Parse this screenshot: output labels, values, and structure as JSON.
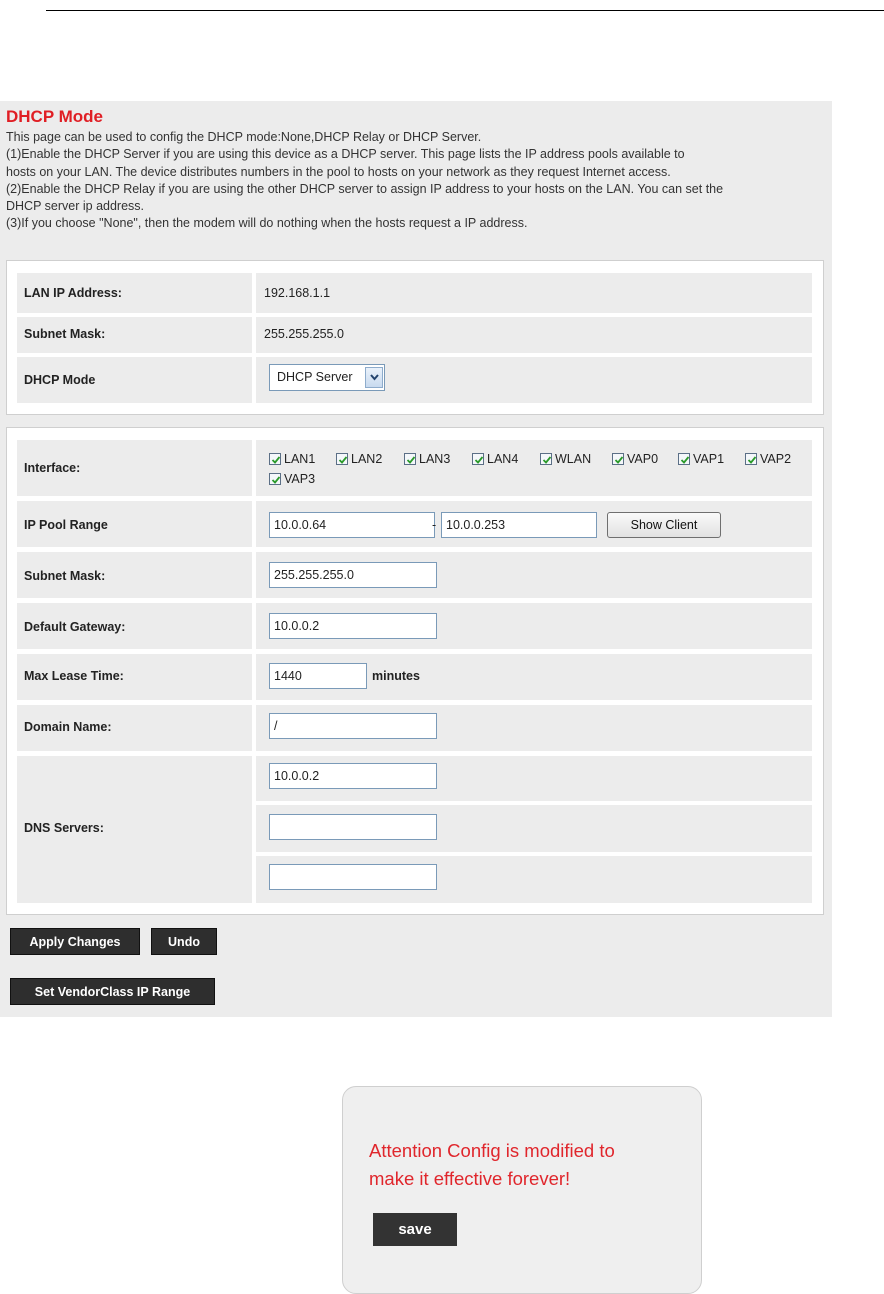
{
  "title": "DHCP Mode",
  "description": [
    "This page can be used to config the DHCP mode:None,DHCP Relay or DHCP Server.",
    "(1)Enable the DHCP Server if you are using this device as a DHCP server. This page lists the IP address pools available to",
    "hosts on your LAN. The device distributes numbers in the pool to hosts on your network as they request Internet access.",
    "(2)Enable the DHCP Relay if you are using the other DHCP server to assign IP address to your hosts on the LAN. You can set the",
    "DHCP server ip address.",
    "(3)If you choose \"None\", then the modem will do nothing when the hosts request a IP address."
  ],
  "lan": {
    "ip_label": "LAN IP Address:",
    "ip_value": "192.168.1.1",
    "mask_label": "Subnet Mask:",
    "mask_value": "255.255.255.0",
    "mode_label": "DHCP Mode",
    "mode_value": "DHCP Server"
  },
  "server": {
    "interface_label": "Interface:",
    "interfaces": [
      {
        "name": "LAN1",
        "checked": true
      },
      {
        "name": "LAN2",
        "checked": true
      },
      {
        "name": "LAN3",
        "checked": true
      },
      {
        "name": "LAN4",
        "checked": true
      },
      {
        "name": "WLAN",
        "checked": true
      },
      {
        "name": "VAP0",
        "checked": true
      },
      {
        "name": "VAP1",
        "checked": true
      },
      {
        "name": "VAP2",
        "checked": true
      },
      {
        "name": "VAP3",
        "checked": true
      }
    ],
    "pool_label": "IP Pool Range",
    "pool_start": "10.0.0.64",
    "pool_separator": "-",
    "pool_end": "10.0.0.253",
    "show_client": "Show Client",
    "mask_label": "Subnet Mask:",
    "mask_value": "255.255.255.0",
    "gateway_label": "Default Gateway:",
    "gateway_value": "10.0.0.2",
    "lease_label": "Max Lease Time:",
    "lease_value": "1440",
    "lease_unit": "minutes",
    "domain_label": "Domain Name:",
    "domain_value": "/",
    "dns_label": "DNS Servers:",
    "dns": [
      "10.0.0.2",
      "",
      ""
    ]
  },
  "buttons": {
    "apply": "Apply Changes",
    "undo": "Undo",
    "vendor": "Set VendorClass IP Range"
  },
  "notice": {
    "line1": "Attention Config is modified to",
    "line2": "make it effective forever!",
    "save": "save"
  },
  "colors": {
    "title": "#e01e24",
    "notice_text": "#e0262c",
    "panel_bg": "#ececec",
    "dark_button": "#2e2e2e"
  }
}
